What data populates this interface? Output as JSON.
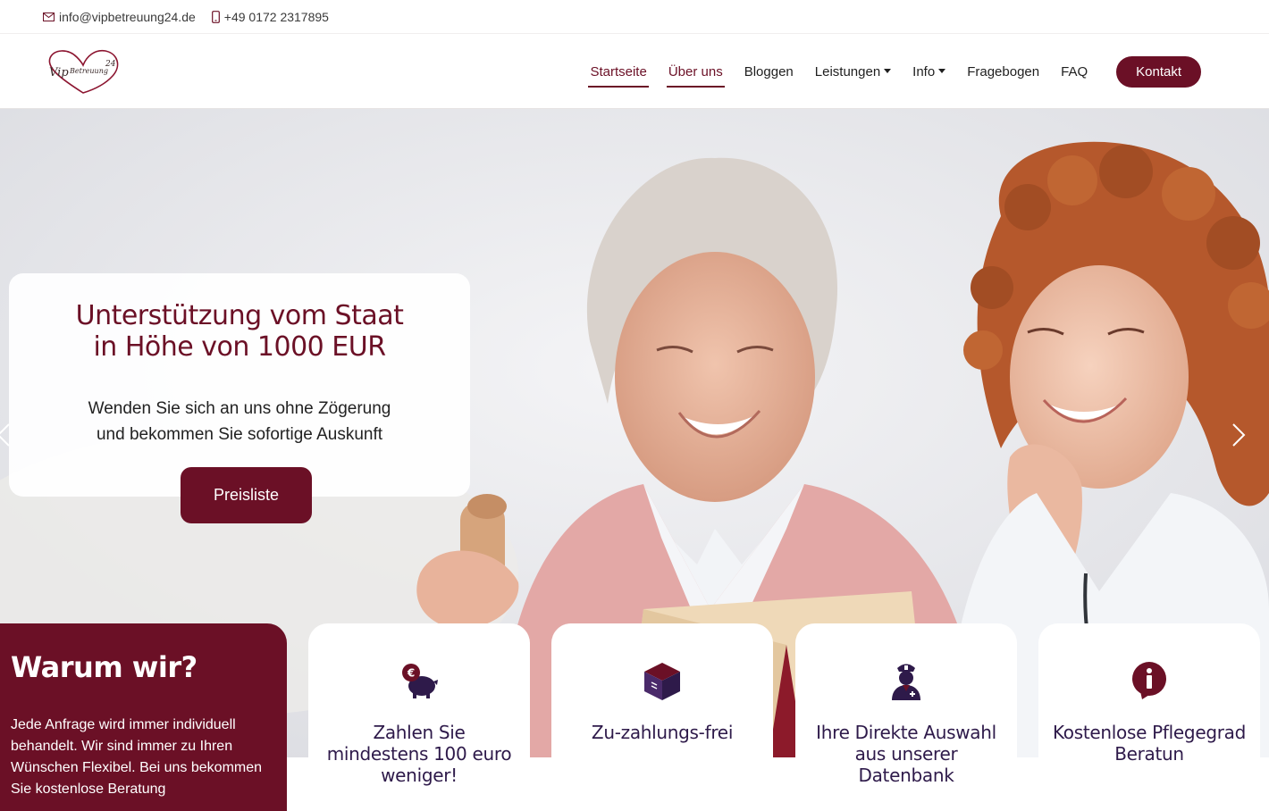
{
  "topbar": {
    "email": "info@vipbetreuung24.de",
    "phone": "+49 0172 2317895"
  },
  "logo": {
    "alt": "VipBetreuung24"
  },
  "nav": {
    "items": [
      {
        "label": "Startseite",
        "active": true,
        "dropdown": false
      },
      {
        "label": "Über uns",
        "active": true,
        "dropdown": false
      },
      {
        "label": "Bloggen",
        "active": false,
        "dropdown": false
      },
      {
        "label": "Leistungen",
        "active": false,
        "dropdown": true
      },
      {
        "label": "Info",
        "active": false,
        "dropdown": true
      },
      {
        "label": "Fragebogen",
        "active": false,
        "dropdown": false
      },
      {
        "label": "FAQ",
        "active": false,
        "dropdown": false
      }
    ],
    "cta_label": "Kontakt"
  },
  "hero": {
    "title_line1": "Unterstützung vom Staat",
    "title_line2": "in Höhe von 1000 EUR",
    "text_line1": "Wenden Sie sich an uns ohne Zögerung",
    "text_line2": "und bekommen Sie sofortige Auskunft",
    "button_label": "Preisliste"
  },
  "why": {
    "title": "Warum wir?",
    "text": "Jede Anfrage wird immer individuell behandelt. Wir sind immer zu Ihren Wünschen Flexibel. Bei uns bekommen Sie kostenlose Beratung"
  },
  "features": [
    {
      "title": "Zahlen Sie mindestens 100 euro weniger!",
      "icon": "piggy-bank-euro-icon"
    },
    {
      "title": "Zu-zahlungs-frei",
      "icon": "box-icon"
    },
    {
      "title": "Ihre Direkte Auswahl aus unserer Datenbank",
      "icon": "nurse-icon"
    },
    {
      "title": "Kostenlose Pflegegrad Beratun",
      "icon": "info-circle-icon"
    }
  ],
  "colors": {
    "brand": "#6b1026",
    "feature_title": "#2e1a4a"
  }
}
